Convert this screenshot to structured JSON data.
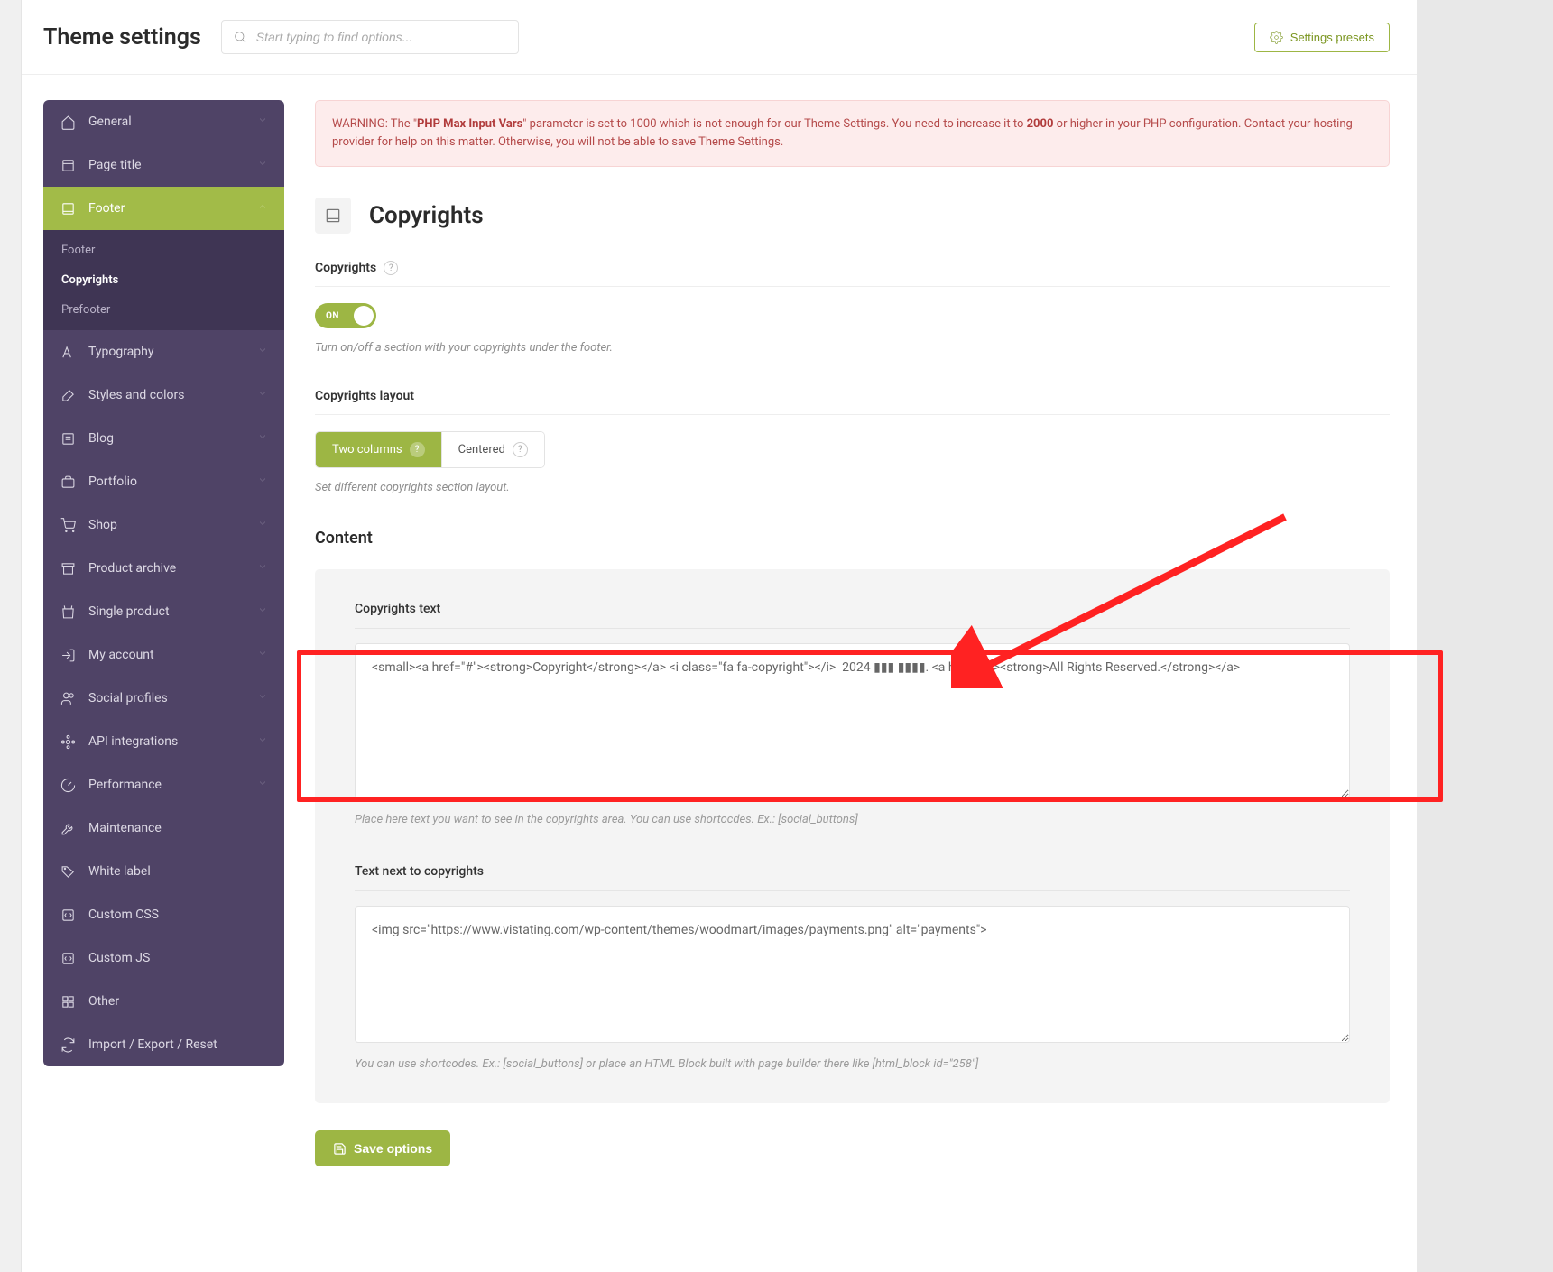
{
  "header": {
    "title": "Theme settings",
    "search_placeholder": "Start typing to find options...",
    "presets_button": "Settings presets"
  },
  "sidebar": {
    "items": [
      {
        "label": "General",
        "expandable": true
      },
      {
        "label": "Page title",
        "expandable": true
      },
      {
        "label": "Footer",
        "expandable": true,
        "active": true,
        "sub": [
          {
            "label": "Footer"
          },
          {
            "label": "Copyrights",
            "active": true
          },
          {
            "label": "Prefooter"
          }
        ]
      },
      {
        "label": "Typography",
        "expandable": true
      },
      {
        "label": "Styles and colors",
        "expandable": true
      },
      {
        "label": "Blog",
        "expandable": true
      },
      {
        "label": "Portfolio",
        "expandable": true
      },
      {
        "label": "Shop",
        "expandable": true
      },
      {
        "label": "Product archive",
        "expandable": true
      },
      {
        "label": "Single product",
        "expandable": true
      },
      {
        "label": "My account",
        "expandable": true
      },
      {
        "label": "Social profiles",
        "expandable": true
      },
      {
        "label": "API integrations",
        "expandable": true
      },
      {
        "label": "Performance",
        "expandable": true
      },
      {
        "label": "Maintenance",
        "expandable": false
      },
      {
        "label": "White label",
        "expandable": false
      },
      {
        "label": "Custom CSS",
        "expandable": false
      },
      {
        "label": "Custom JS",
        "expandable": false
      },
      {
        "label": "Other",
        "expandable": false
      },
      {
        "label": "Import / Export / Reset",
        "expandable": false
      }
    ]
  },
  "warning": {
    "prefix": "WARNING: The \"",
    "param": "PHP Max Input Vars",
    "mid1": "\" parameter is set to 1000 which is not enough for our Theme Settings. You need to increase it to ",
    "val": "2000",
    "suffix": " or higher in your PHP configuration. Contact your hosting provider for help on this matter. Otherwise, you will not be able to save Theme Settings."
  },
  "section": {
    "title": "Copyrights"
  },
  "fields": {
    "copyrights": {
      "label": "Copyrights",
      "toggle_on": "ON",
      "desc": "Turn on/off a section with your copyrights under the footer."
    },
    "layout": {
      "label": "Copyrights layout",
      "options": [
        "Two columns",
        "Centered"
      ],
      "active": 0,
      "desc": "Set different copyrights section layout."
    },
    "content_heading": "Content",
    "copy_text": {
      "label": "Copyrights text",
      "value": "<small><a href=\"#\"><strong>Copyright</strong></a> <i class=\"fa fa-copyright\"></i>  2024 ▮▮▮ ▮▮▮▮. <a href=\"#\"><strong>All Rights Reserved.</strong></a>",
      "desc": "Place here text you want to see in the copyrights area. You can use shortocdes. Ex.: [social_buttons]"
    },
    "next_text": {
      "label": "Text next to copyrights",
      "value": "<img src=\"https://www.vistating.com/wp-content/themes/woodmart/images/payments.png\" alt=\"payments\">",
      "desc": "You can use shortcodes. Ex.: [social_buttons] or place an HTML Block built with page builder there like [html_block id=\"258\"]"
    }
  },
  "save_button": "Save options"
}
